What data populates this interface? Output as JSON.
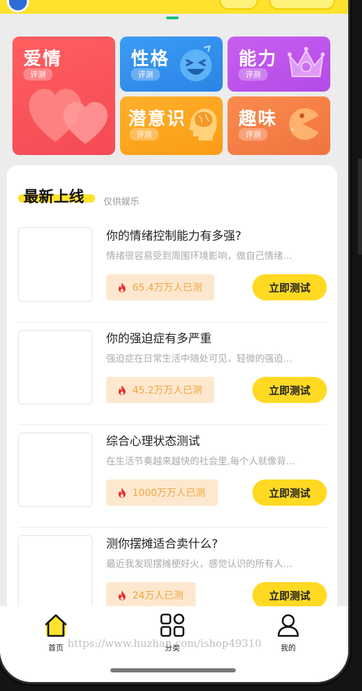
{
  "categories": [
    {
      "title": "爱情",
      "badge": "评测",
      "color": "#f44a55",
      "icon": "hearts-icon"
    },
    {
      "title": "性格",
      "badge": "评测",
      "color": "#2a84e6",
      "icon": "laughing-face-icon"
    },
    {
      "title": "能力",
      "badge": "评测",
      "color": "#b24be6",
      "icon": "crown-icon"
    },
    {
      "title": "潜意识",
      "badge": "评测",
      "color": "#fb9c15",
      "icon": "brain-head-icon"
    },
    {
      "title": "趣味",
      "badge": "评测",
      "color": "#ef7440",
      "icon": "pacman-icon"
    }
  ],
  "section": {
    "title": "最新上线",
    "subtitle": "仅供娱乐"
  },
  "items": [
    {
      "title": "你的情绪控制能力有多强?",
      "desc": "情绪很容易受到周围环境影响，做自己情绪…",
      "count": "65.4万万人已测",
      "button": "立即测试"
    },
    {
      "title": "你的强迫症有多严重",
      "desc": "强迫症在日常生活中随处可见，轻微的强迫…",
      "count": "45.2万万人已测",
      "button": "立即测试"
    },
    {
      "title": "综合心理状态测试",
      "desc": "在生活节奏越来越快的社会里,每个人就像背…",
      "count": "1000万万人已测",
      "button": "立即测试"
    },
    {
      "title": "测你摆摊适合卖什么?",
      "desc": "最近我发现摆摊梗好火，感觉认识的所有人…",
      "count": "24万人已测",
      "button": "立即测试"
    }
  ],
  "nav": [
    {
      "label": "首页",
      "icon": "home-icon",
      "active": true
    },
    {
      "label": "分类",
      "icon": "grid-icon",
      "active": false
    },
    {
      "label": "我的",
      "icon": "user-icon",
      "active": false
    }
  ],
  "watermark": "https://www.huzhan.com/ishop49310",
  "colors": {
    "accent": "#ffd922",
    "count_bg": "#fde8cf",
    "count_text": "#f2a23d"
  }
}
